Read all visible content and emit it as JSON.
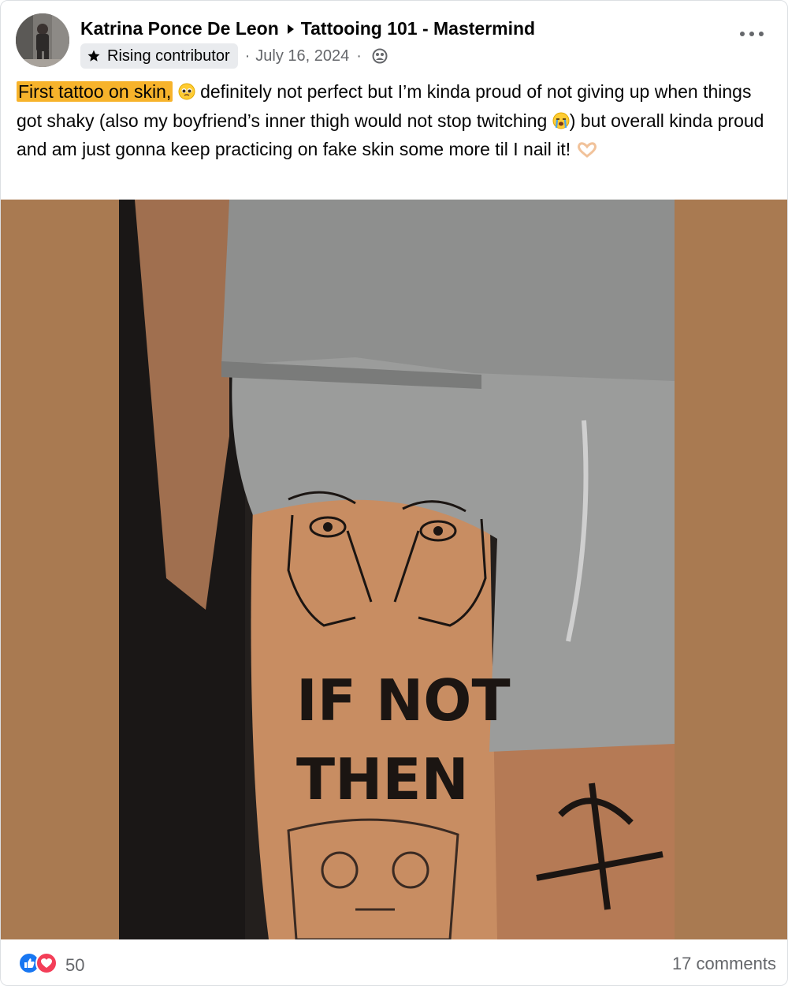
{
  "post": {
    "author": "Katrina Ponce De Leon",
    "group": "Tattooing 101 - Mastermind",
    "badge": "Rising contributor",
    "date": "July 16, 2024",
    "separator": "·",
    "text_highlight": "First tattoo on skin,",
    "text_part1": " definitely not perfect but I’m kinda proud of not giving up when things got shaky (also my boyfriend’s inner thigh would not stop twitching ",
    "text_part2": ") but overall kinda proud and am just gonna keep practicing on fake skin some more til I nail it! ",
    "tattoo_text_line1": "IF NOT",
    "tattoo_text_line2": "THEN"
  },
  "footer": {
    "reaction_count": "50",
    "comments": "17 comments"
  },
  "icons": {
    "like_color": "#1877f2",
    "love_color": "#f33e58",
    "highlight_color": "#f7b32b",
    "photo_bg_color": "#a97a51"
  }
}
